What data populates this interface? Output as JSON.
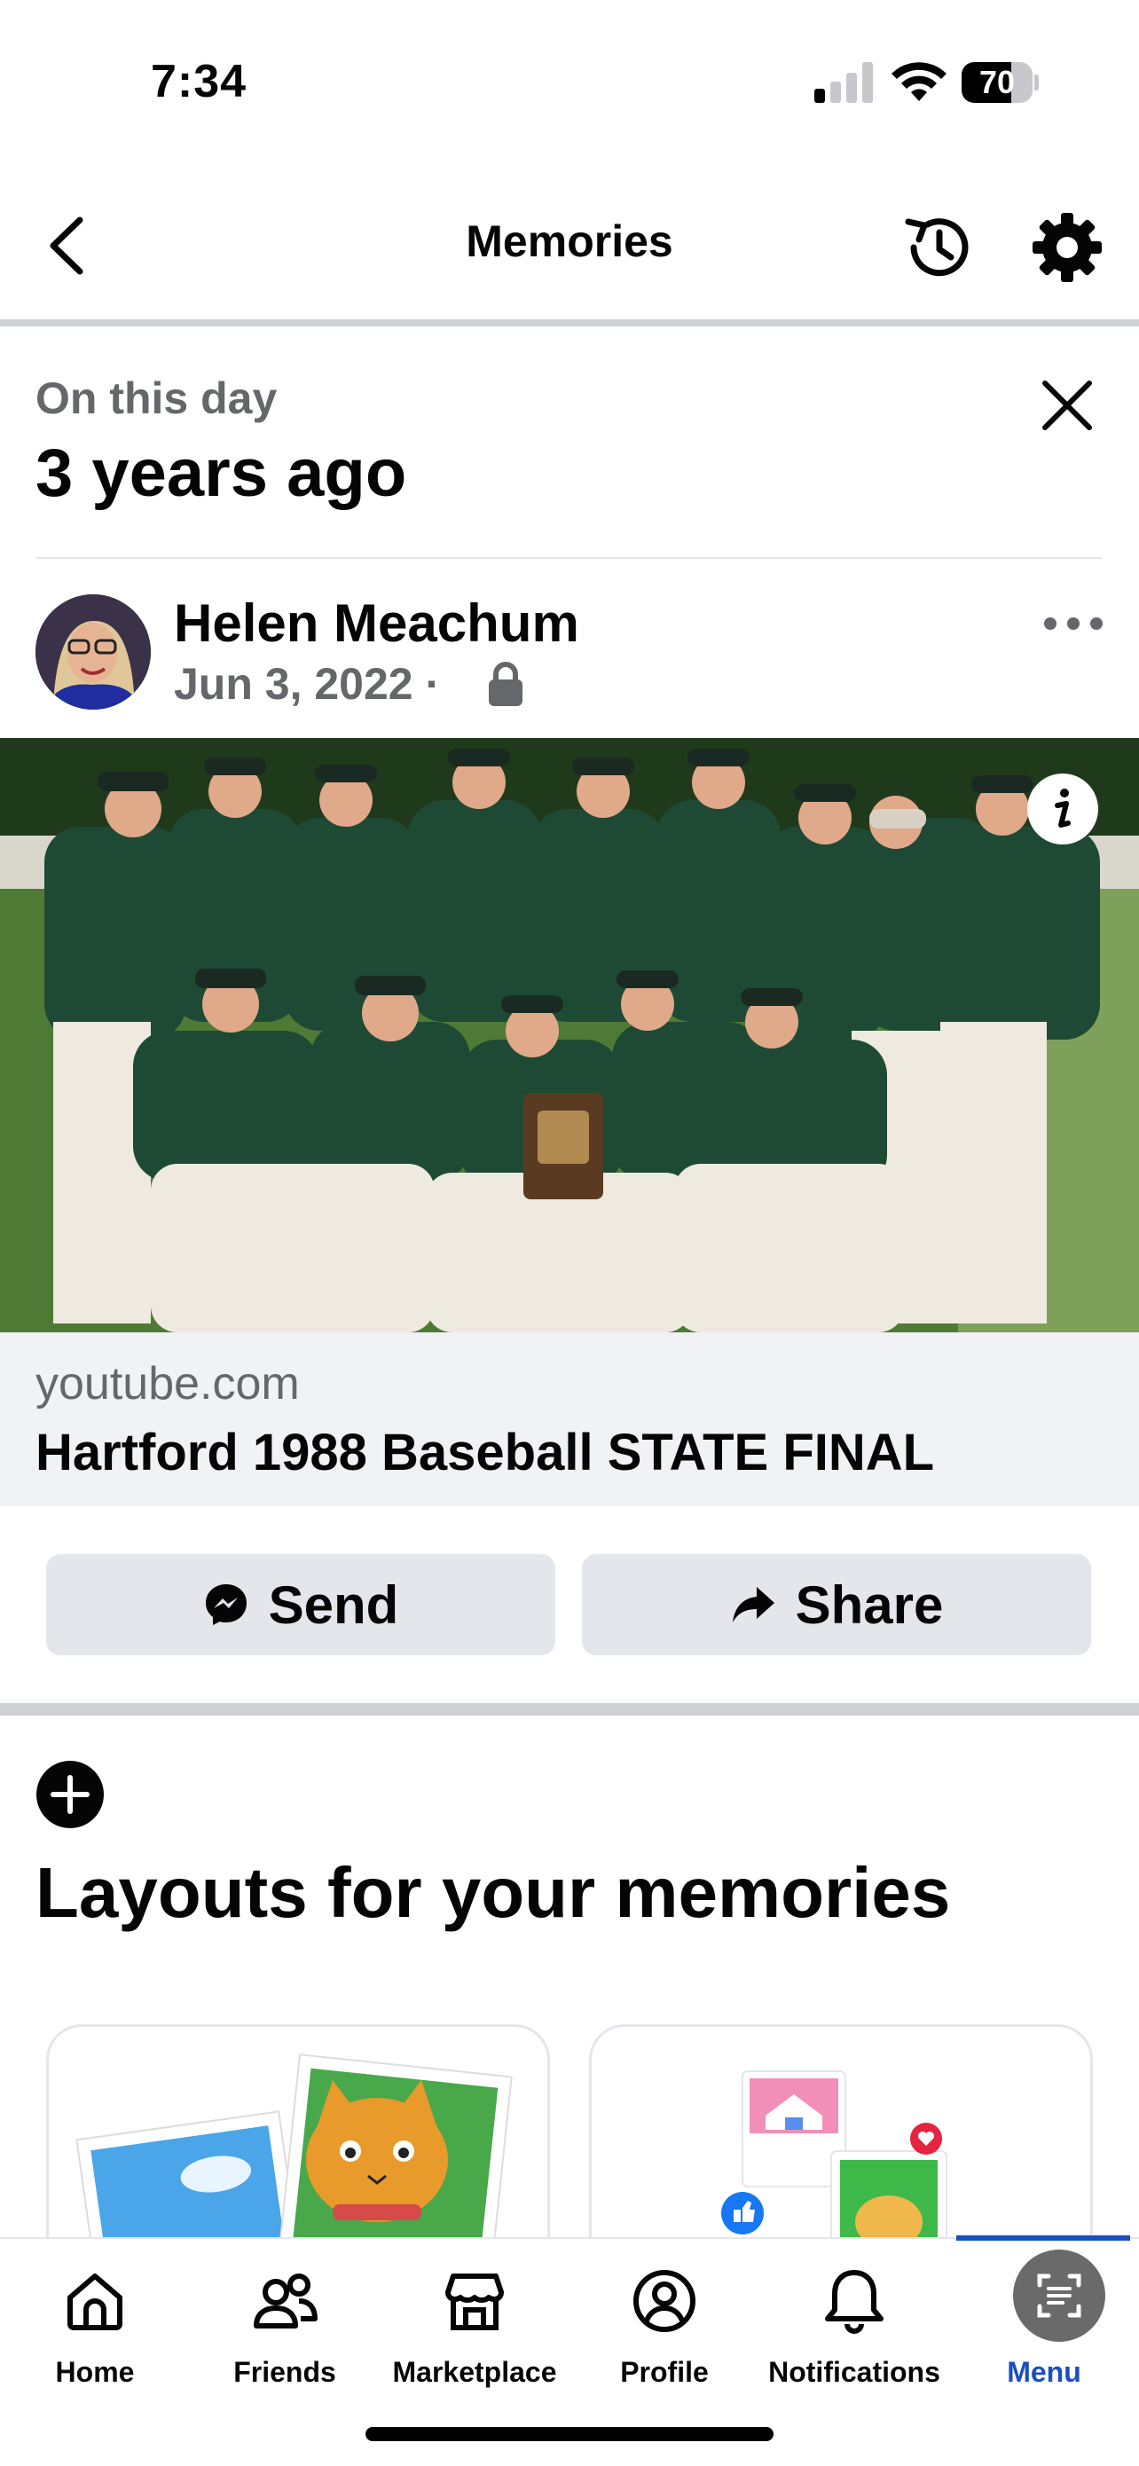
{
  "status_bar": {
    "time": "7:34",
    "battery": "70",
    "battery_level": 0.7
  },
  "header": {
    "title": "Memories"
  },
  "on_this_day": {
    "label": "On this day",
    "title": "3 years ago"
  },
  "post": {
    "author": "Helen Meachum",
    "date": "Jun 3, 2022 ·",
    "privacy_icon": "lock-icon",
    "link_domain": "youtube.com",
    "link_title": "Hartford 1988 Baseball STATE FINAL"
  },
  "actions": {
    "send": "Send",
    "share": "Share"
  },
  "layouts": {
    "title": "Layouts for your memories"
  },
  "nav": {
    "items": [
      {
        "label": "Home",
        "icon": "home-icon"
      },
      {
        "label": "Friends",
        "icon": "friends-icon"
      },
      {
        "label": "Marketplace",
        "icon": "marketplace-icon"
      },
      {
        "label": "Profile",
        "icon": "profile-icon"
      },
      {
        "label": "Notifications",
        "icon": "bell-icon"
      },
      {
        "label": "Menu",
        "icon": "menu-icon"
      }
    ],
    "active": "Menu"
  },
  "colors": {
    "accent": "#1b4fbf",
    "secondary_text": "#65676b",
    "button_bg": "#e4e6eb",
    "divider": "#ced0d4"
  }
}
